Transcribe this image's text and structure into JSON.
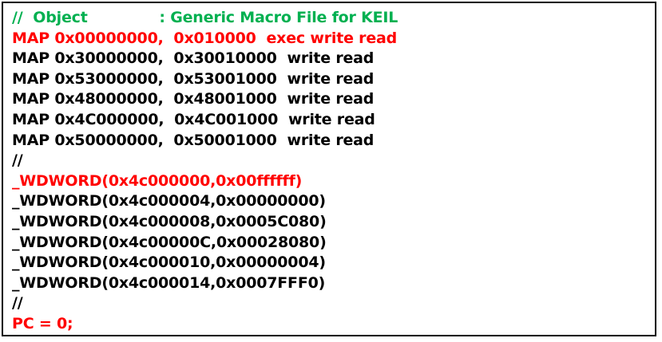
{
  "colors": {
    "comment": "#00b050",
    "highlight": "#ff0000",
    "normal": "#000000",
    "border": "#000000"
  },
  "lines": [
    {
      "text": "//  Object              : Generic Macro File for KEIL",
      "color": "green"
    },
    {
      "text": "MAP 0x00000000,  0x010000  exec write read",
      "color": "red"
    },
    {
      "text": "MAP 0x30000000,  0x30010000  write read",
      "color": "black"
    },
    {
      "text": "MAP 0x53000000,  0x53001000  write read",
      "color": "black"
    },
    {
      "text": "MAP 0x48000000,  0x48001000  write read",
      "color": "black"
    },
    {
      "text": "MAP 0x4C000000,  0x4C001000  write read",
      "color": "black"
    },
    {
      "text": "MAP 0x50000000,  0x50001000  write read",
      "color": "black"
    },
    {
      "text": "//",
      "color": "black"
    },
    {
      "text": "_WDWORD(0x4c000000,0x00ffffff)",
      "color": "red"
    },
    {
      "text": "_WDWORD(0x4c000004,0x00000000)",
      "color": "black"
    },
    {
      "text": "_WDWORD(0x4c000008,0x0005C080)",
      "color": "black"
    },
    {
      "text": "_WDWORD(0x4c00000C,0x00028080)",
      "color": "black"
    },
    {
      "text": "_WDWORD(0x4c000010,0x00000004)",
      "color": "black"
    },
    {
      "text": "_WDWORD(0x4c000014,0x0007FFF0)",
      "color": "black"
    },
    {
      "text": "//",
      "color": "black"
    },
    {
      "text": "PC = 0;",
      "color": "red"
    }
  ]
}
